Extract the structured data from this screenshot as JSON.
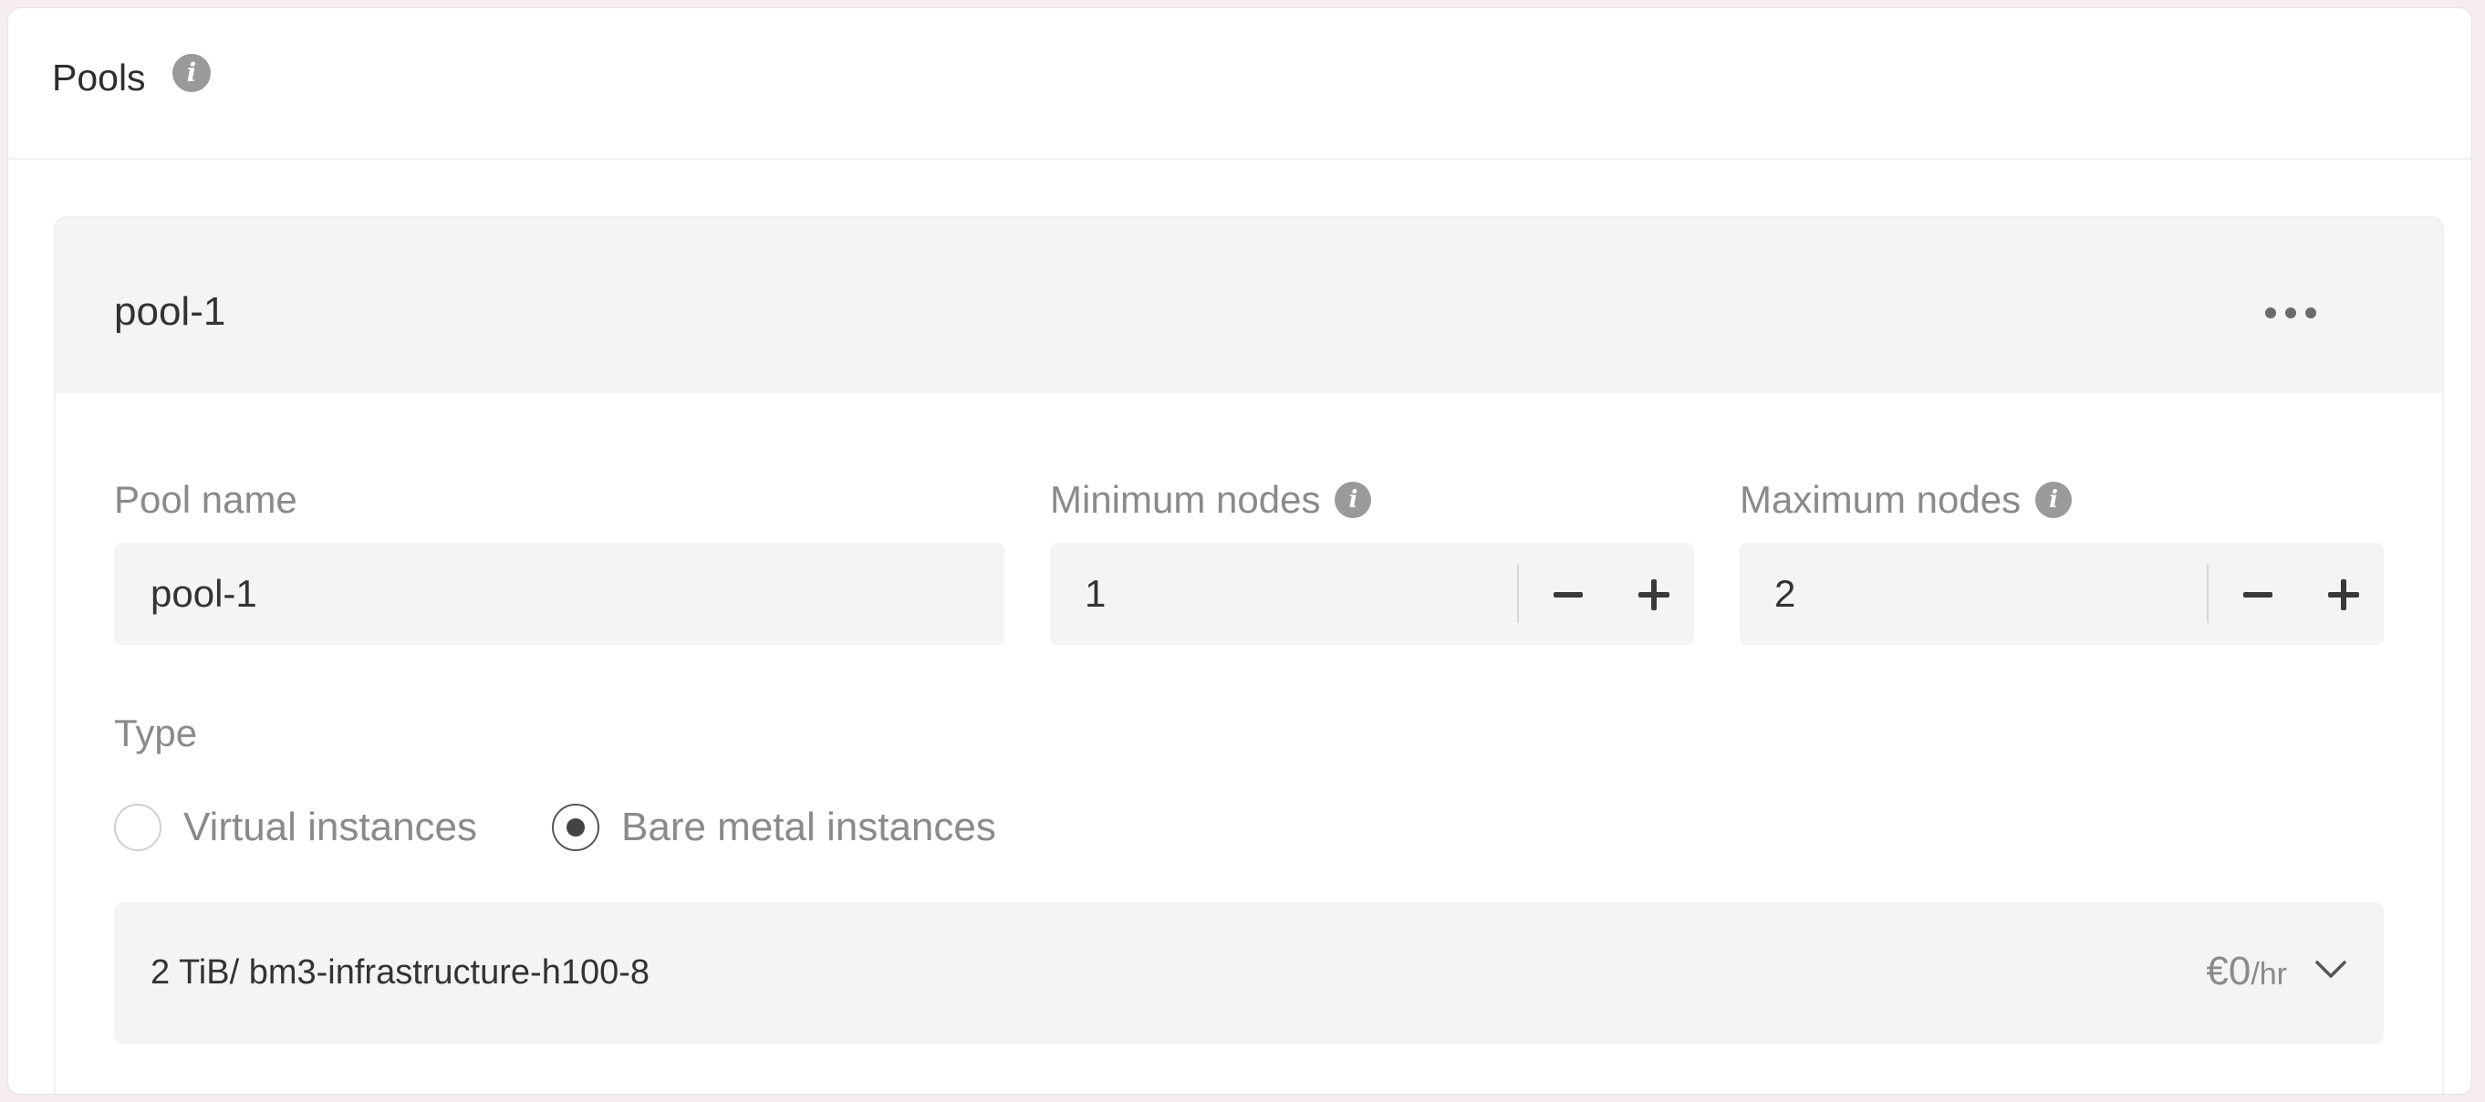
{
  "card": {
    "title": "Pools",
    "title_info_icon": "info-icon"
  },
  "pool": {
    "header_name": "pool-1",
    "more_icon": "more-horizontal-icon"
  },
  "form": {
    "pool_name": {
      "label": "Pool name",
      "value": "pool-1"
    },
    "min_nodes": {
      "label": "Minimum nodes",
      "info_icon": "info-icon",
      "value": "1",
      "decrement_icon": "minus-icon",
      "increment_icon": "plus-icon"
    },
    "max_nodes": {
      "label": "Maximum nodes",
      "info_icon": "info-icon",
      "value": "2",
      "decrement_icon": "minus-icon",
      "increment_icon": "plus-icon"
    },
    "type": {
      "label": "Type",
      "options": [
        {
          "label": "Virtual instances",
          "checked": false
        },
        {
          "label": "Bare metal instances",
          "checked": true
        }
      ]
    },
    "instance_type": {
      "selected": "2 TiB/ bm3-infrastructure-h100-8",
      "price": "€0",
      "price_unit": "/hr",
      "chevron_icon": "chevron-down-icon"
    }
  },
  "colors": {
    "background": "#f5ecee",
    "panel_header": "#f4f4f4",
    "input_background": "#f4f4f4",
    "muted_text": "#8a8a8a",
    "info_icon": "#9a9a9a"
  }
}
